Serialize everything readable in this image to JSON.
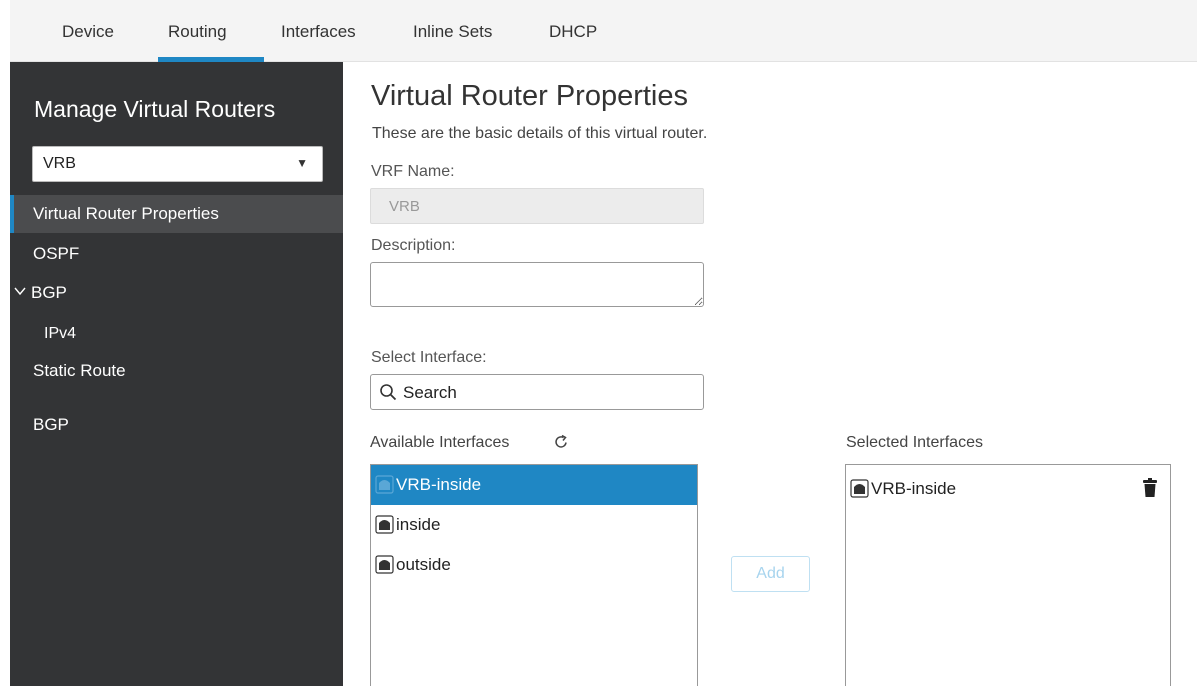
{
  "topnav": {
    "tabs": [
      "Device",
      "Routing",
      "Interfaces",
      "Inline Sets",
      "DHCP"
    ],
    "active_tab": "Routing"
  },
  "sidebar": {
    "title": "Manage Virtual Routers",
    "router_select": {
      "value": "VRB"
    },
    "items": [
      {
        "label": "Virtual Router Properties",
        "active": true
      },
      {
        "label": "OSPF"
      },
      {
        "label": "BGP",
        "expanded": true,
        "icon": "chevron-down-icon"
      },
      {
        "label": "IPv4",
        "indent": true
      },
      {
        "label": "Static Route"
      },
      {
        "label": "BGP"
      }
    ]
  },
  "main": {
    "title": "Virtual Router Properties",
    "subtitle": "These are the basic details of this virtual router.",
    "vrf_name": {
      "label": "VRF Name:",
      "value": "VRB"
    },
    "description": {
      "label": "Description:",
      "value": ""
    },
    "select_interface": {
      "label": "Select Interface:",
      "placeholder": "Search"
    },
    "available": {
      "label": "Available Interfaces",
      "refresh_icon": "refresh-icon",
      "items": [
        {
          "label": "VRB-inside",
          "selected": true
        },
        {
          "label": "inside"
        },
        {
          "label": "outside"
        }
      ]
    },
    "add_label": "Add",
    "selected": {
      "label": "Selected Interfaces",
      "items": [
        {
          "label": "VRB-inside"
        }
      ],
      "delete_icon": "trash-icon"
    }
  },
  "colors": {
    "accent": "#1f87c4",
    "sidebar_bg": "#333436",
    "sidebar_active_bg": "#4b4c4e"
  }
}
